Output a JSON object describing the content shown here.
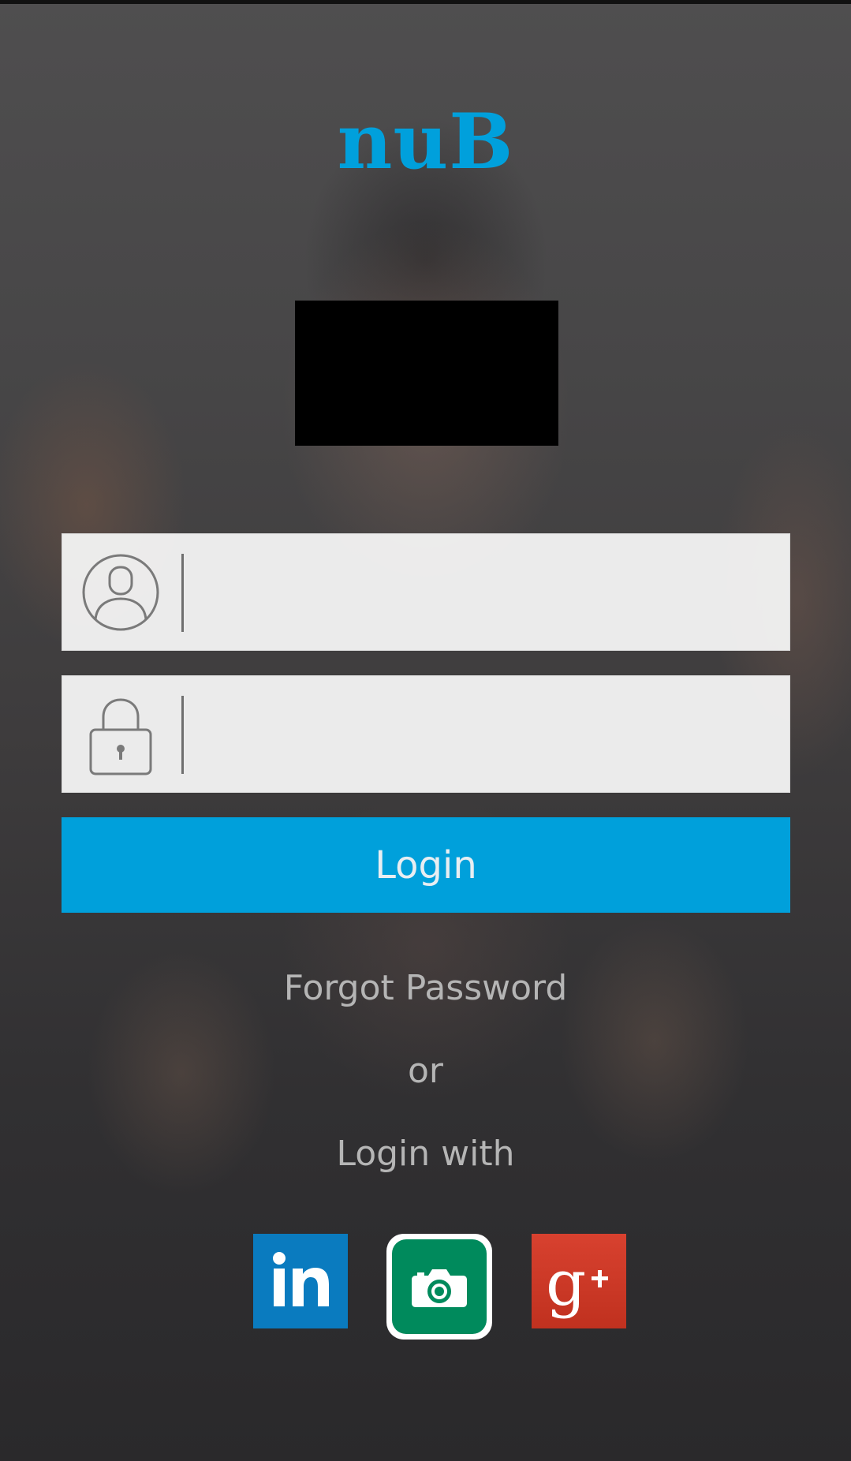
{
  "app": {
    "title": "nuB"
  },
  "login_form": {
    "username_placeholder": "",
    "password_placeholder": "",
    "login_label": "Login",
    "forgot_password_label": "Forgot Password",
    "or_label": "or",
    "login_with_label": "Login with"
  },
  "icons": {
    "username": "user-avatar-icon",
    "password": "padlock-icon"
  },
  "social_logins": [
    {
      "name": "linkedin",
      "icon": "linkedin-icon",
      "color": "#0a7bbf"
    },
    {
      "name": "camera",
      "icon": "camera-icon",
      "color": "#008a5c"
    },
    {
      "name": "google-plus",
      "icon": "google-plus-icon",
      "color": "#d2392a"
    }
  ],
  "colors": {
    "accent": "#00a0db",
    "title": "#00a0dc",
    "link_text": "#b5b5b5"
  }
}
